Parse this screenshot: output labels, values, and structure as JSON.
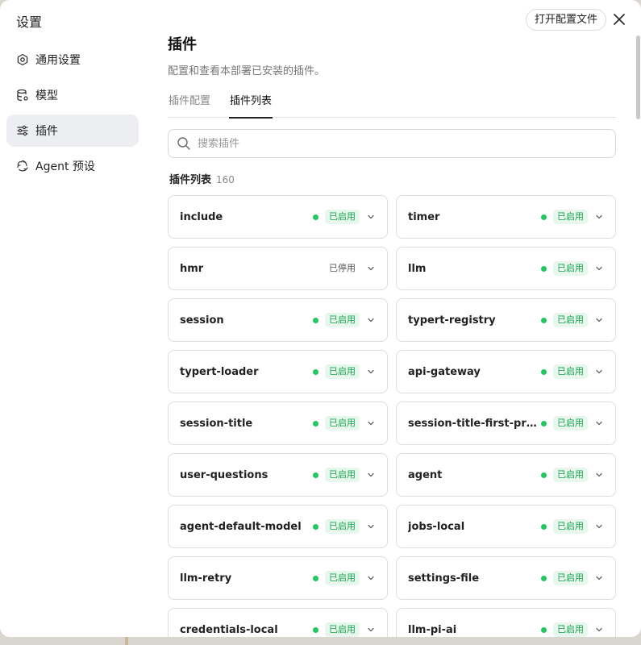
{
  "dialog": {
    "title": "设置",
    "open_config_label": "打开配置文件"
  },
  "sidebar": {
    "items": [
      {
        "label": "通用设置",
        "icon": "gear-icon",
        "active": false
      },
      {
        "label": "模型",
        "icon": "database-icon",
        "active": false
      },
      {
        "label": "插件",
        "icon": "sliders-icon",
        "active": true
      },
      {
        "label": "Agent 预设",
        "icon": "recycle-icon",
        "active": false
      }
    ]
  },
  "main": {
    "title": "插件",
    "description": "配置和查看本部署已安装的插件。",
    "tabs": [
      {
        "label": "插件配置",
        "active": false
      },
      {
        "label": "插件列表",
        "active": true
      }
    ],
    "search_placeholder": "搜索插件",
    "list_title": "插件列表",
    "list_count": "160"
  },
  "status_labels": {
    "enabled": "已启用",
    "disabled": "已停用"
  },
  "colors": {
    "enabled_dot": "#22c55e",
    "enabled_text": "#16a34a",
    "enabled_bg": "#e8f7ee",
    "active_nav_bg": "#eceef1"
  },
  "plugins": [
    {
      "name": "include",
      "status": "已启用",
      "enabled": true
    },
    {
      "name": "timer",
      "status": "已启用",
      "enabled": true
    },
    {
      "name": "hmr",
      "status": "已停用",
      "enabled": false
    },
    {
      "name": "llm",
      "status": "已启用",
      "enabled": true
    },
    {
      "name": "session",
      "status": "已启用",
      "enabled": true
    },
    {
      "name": "typert-registry",
      "status": "已启用",
      "enabled": true
    },
    {
      "name": "typert-loader",
      "status": "已启用",
      "enabled": true
    },
    {
      "name": "api-gateway",
      "status": "已启用",
      "enabled": true
    },
    {
      "name": "session-title",
      "status": "已启用",
      "enabled": true
    },
    {
      "name": "session-title-first-pro…",
      "status": "已启用",
      "enabled": true
    },
    {
      "name": "user-questions",
      "status": "已启用",
      "enabled": true
    },
    {
      "name": "agent",
      "status": "已启用",
      "enabled": true
    },
    {
      "name": "agent-default-model",
      "status": "已启用",
      "enabled": true
    },
    {
      "name": "jobs-local",
      "status": "已启用",
      "enabled": true
    },
    {
      "name": "llm-retry",
      "status": "已启用",
      "enabled": true
    },
    {
      "name": "settings-file",
      "status": "已启用",
      "enabled": true
    },
    {
      "name": "credentials-local",
      "status": "已启用",
      "enabled": true
    },
    {
      "name": "llm-pi-ai",
      "status": "已启用",
      "enabled": true
    }
  ]
}
